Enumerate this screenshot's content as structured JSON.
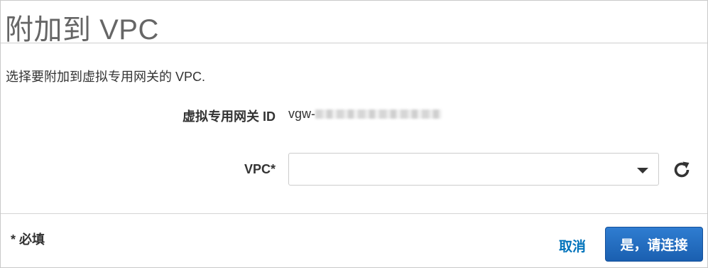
{
  "dialog": {
    "title": "附加到 VPC",
    "description": "选择要附加到虚拟专用网关的 VPC.",
    "fields": {
      "gateway_label": "虚拟专用网关 ID",
      "gateway_value_prefix": "vgw-",
      "vpc_label": "VPC*",
      "vpc_selected": ""
    },
    "icons": {
      "dropdown": "chevron-down-icon",
      "refresh": "refresh-icon"
    },
    "footer": {
      "required_note": "* 必填",
      "cancel_label": "取消",
      "confirm_label": "是，请连接"
    },
    "colors": {
      "primary_button": "#1f6dc4",
      "link": "#0073bb",
      "title": "#666666"
    }
  }
}
